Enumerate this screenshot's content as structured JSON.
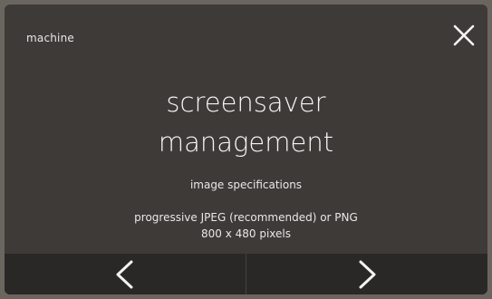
{
  "header": {
    "section_label": "machine",
    "close_icon": "close-icon"
  },
  "main": {
    "title_line1": "screensaver",
    "title_line2": "management",
    "spec_heading": "image specifications",
    "format_text": "progressive JPEG (recommended) or PNG",
    "dimension_text": "800 x 480 pixels"
  },
  "footer": {
    "prev_icon": "chevron-left-icon",
    "next_icon": "chevron-right-icon"
  },
  "colors": {
    "panel_bg": "#3d3a38",
    "footer_bg": "#2a2827",
    "text": "#f2f2f2"
  }
}
